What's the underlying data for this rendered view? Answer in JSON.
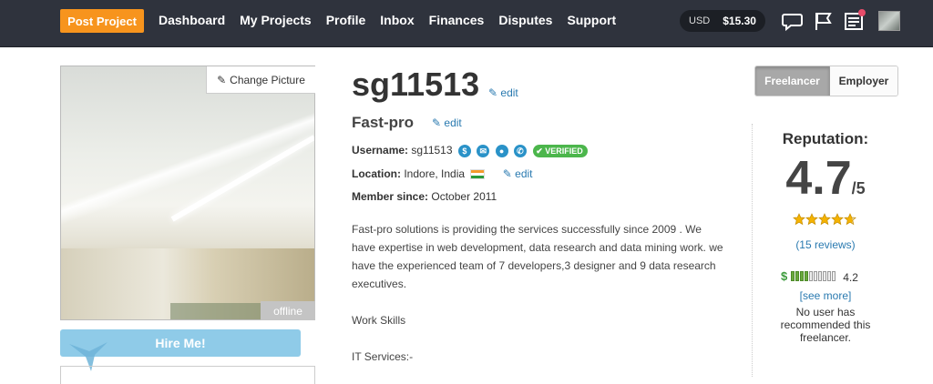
{
  "nav": {
    "post_project": "Post Project",
    "links": [
      "Dashboard",
      "My Projects",
      "Profile",
      "Inbox",
      "Finances",
      "Disputes",
      "Support"
    ],
    "balance_currency": "USD",
    "balance_amount": "$15.30",
    "icons": [
      "chat-icon",
      "flag-icon",
      "notifications-icon",
      "user-avatar"
    ],
    "notification_dot_color": "#e84c6a"
  },
  "profile": {
    "change_picture": "Change Picture",
    "status": "offline",
    "hire_label": "Hire Me!",
    "username_heading": "sg11513",
    "edit_label": "edit",
    "tagline": "Fast-pro",
    "username_label": "Username:",
    "username_value": "sg11513",
    "verified_label": "VERIFIED",
    "location_label": "Location:",
    "location_value": "Indore, India",
    "member_label": "Member since:",
    "member_value": "October 2011",
    "description": [
      "Fast-pro solutions is providing the services successfully since 2009 . We have expertise in web development, data research and data mining work. we have the experienced team of 7 developers,3 designer and 9 data research executives.",
      "",
      "Work Skills",
      "",
      "IT Services:-"
    ]
  },
  "reputation": {
    "toggle_freelancer": "Freelancer",
    "toggle_employer": "Employer",
    "title": "Reputation:",
    "score": "4.7",
    "out_of": "/5",
    "stars": 4.7,
    "reviews": "(15 reviews)",
    "earnings_level": 4.2,
    "earnings_value": "4.2",
    "see_more": "[see more]",
    "recommend_text": "No user has recommended this freelancer."
  }
}
